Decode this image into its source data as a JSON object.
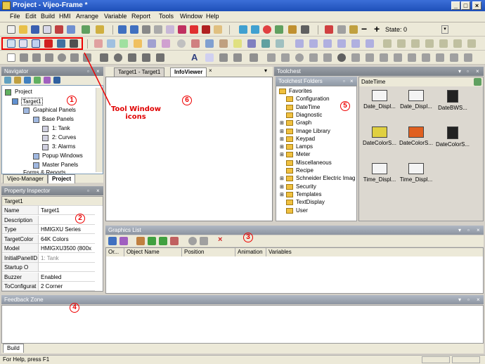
{
  "window": {
    "title": "Project - Vijeo-Frame *"
  },
  "menu": [
    "File",
    "Edit",
    "Build",
    "HMI",
    "Arrange",
    "Variable",
    "Report",
    "Tools",
    "Window",
    "Help"
  ],
  "toolbar": {
    "state_label": "State: 0"
  },
  "navigator": {
    "title": "Navigator",
    "tree": [
      "Project",
      "Target1",
      "Graphical Panels",
      "Base Panels",
      "1: Tank",
      "2: Curves",
      "3: Alarms",
      "Popup Windows",
      "Master Panels",
      "Forms & Reports"
    ],
    "tabs": [
      "Vijeo-Manager",
      "Project"
    ]
  },
  "property_inspector": {
    "title": "Property Inspector",
    "header": "Target1",
    "rows": [
      {
        "name": "Name",
        "value": "Target1"
      },
      {
        "name": "Description",
        "value": ""
      },
      {
        "name": "Type",
        "value": "HMIGXU Series"
      },
      {
        "name": "TargetColor",
        "value": "64K Colors"
      },
      {
        "name": "Model",
        "value": "HMIGXU3500 (800x"
      },
      {
        "name": "InitialPanelID",
        "value": "1: Tank"
      },
      {
        "name": "Startup O",
        "value": ""
      },
      {
        "name": "Buzzer",
        "value": "Enabled"
      },
      {
        "name": "ToConfigurat",
        "value": "2 Corner"
      }
    ]
  },
  "editor": {
    "tabs": [
      "Target1 - Target1",
      "InfoViewer"
    ]
  },
  "toolchest": {
    "title": "Toolchest",
    "folders_title": "Toolchest Folders",
    "folders": [
      "Favorites",
      "Configuration",
      "DateTime",
      "Diagnostic",
      "Graph",
      "Image Library",
      "Keypad",
      "Lamps",
      "Meter",
      "Miscellaneous",
      "Recipe",
      "Schneider Electric Imag",
      "Security",
      "Templates",
      "TextDisplay",
      "User"
    ],
    "gallery_title": "DateTime",
    "gallery": [
      "Date_Displ...",
      "Date_Displ...",
      "DateBWS...",
      "DateColorS...",
      "DateColorS...",
      "DateColorS...",
      "Time_Displ...",
      "Time_Displ..."
    ]
  },
  "graphics_list": {
    "title": "Graphics List",
    "columns": [
      "Or...",
      "Object Name",
      "Position",
      "Animation",
      "Variables"
    ]
  },
  "feedback": {
    "title": "Feedback Zone",
    "tab": "Build"
  },
  "status": {
    "text": "For Help, press F1"
  },
  "annotations": {
    "callout": "Tool Window\nicons",
    "numbers": [
      "1",
      "2",
      "3",
      "4",
      "5",
      "6"
    ]
  },
  "colors": {
    "accent_red": "#e00000",
    "titlebar": "#1d4fb8",
    "panel_title": "#8a9098"
  }
}
